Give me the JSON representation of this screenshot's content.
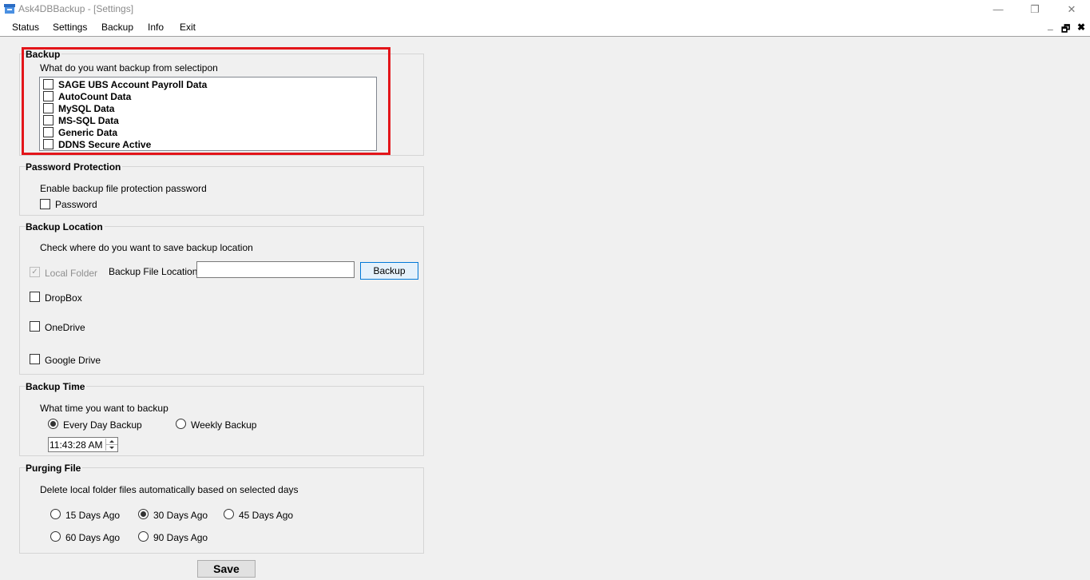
{
  "window": {
    "title": "Ask4DBBackup - [Settings]",
    "minimize_glyph": "—",
    "restore_glyph": "❐",
    "close_glyph": "✕"
  },
  "menu": {
    "items": [
      "Status",
      "Settings",
      "Backup",
      "Info",
      "Exit"
    ],
    "mdi_minimize": "_",
    "mdi_restore": "🗗",
    "mdi_close": "✖"
  },
  "backup_group": {
    "title": "Backup",
    "prompt": "What do you want backup from selectipon",
    "items": [
      {
        "label": "SAGE UBS Account Payroll Data",
        "checked": false
      },
      {
        "label": "AutoCount Data",
        "checked": false
      },
      {
        "label": "MySQL Data",
        "checked": false
      },
      {
        "label": "MS-SQL Data",
        "checked": false
      },
      {
        "label": "Generic Data",
        "checked": false
      },
      {
        "label": "DDNS Secure Active",
        "checked": false
      }
    ]
  },
  "password_group": {
    "title": "Password Protection",
    "prompt": "Enable backup file protection password",
    "password_label": "Password",
    "password_checked": false
  },
  "location_group": {
    "title": "Backup Location",
    "prompt": "Check  where do you want to save backup location",
    "local_folder_label": "Local Folder",
    "local_folder_checked": true,
    "file_location_label": "Backup File Location",
    "file_location_value": "",
    "backup_button": "Backup",
    "dropbox_label": "DropBox",
    "onedrive_label": "OneDrive",
    "google_drive_label": "Google Drive"
  },
  "time_group": {
    "title": "Backup Time",
    "prompt": "What time you want to backup",
    "every_day_label": "Every Day Backup",
    "weekly_label": "Weekly Backup",
    "selected": "Every Day Backup",
    "time_value": "11:43:28 AM"
  },
  "purge_group": {
    "title": "Purging File",
    "prompt": "Delete local folder files automatically based on selected days",
    "options": [
      "15 Days Ago",
      "30 Days Ago",
      "45 Days Ago",
      "60 Days Ago",
      "90 Days Ago"
    ],
    "selected": "30 Days Ago"
  },
  "save_button": "Save",
  "colors": {
    "highlight": "#e3151a",
    "focus_border": "#0078d7"
  }
}
